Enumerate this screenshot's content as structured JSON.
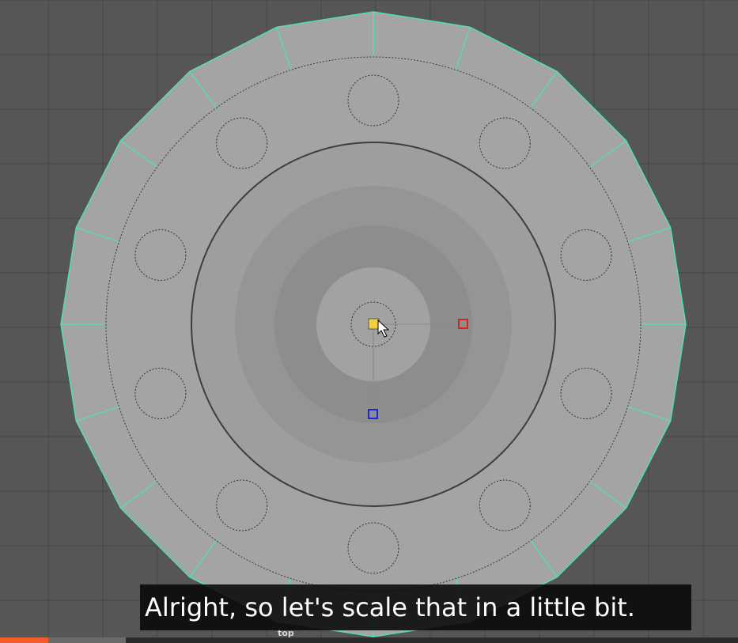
{
  "viewport": {
    "camera_label": "top",
    "colors": {
      "background": "#565656",
      "grid_line": "#454545",
      "mesh_fill": "#a4a4a4",
      "mesh_edge": "#52e0b0",
      "inner_disc": "#9a9a9a",
      "scale_handle_x": "#e02020",
      "scale_handle_y": "#2020e0",
      "scale_handle_center": "#f0d040"
    },
    "icons": {
      "cursor": "arrow-cursor-icon",
      "manipulator": "scale-manipulator-icon"
    }
  },
  "subtitle": {
    "text": "Alright, so let's scale that in a little bit."
  },
  "player": {
    "progress": 0.065,
    "buffered": 0.17,
    "progress_color": "#f25c2a"
  }
}
